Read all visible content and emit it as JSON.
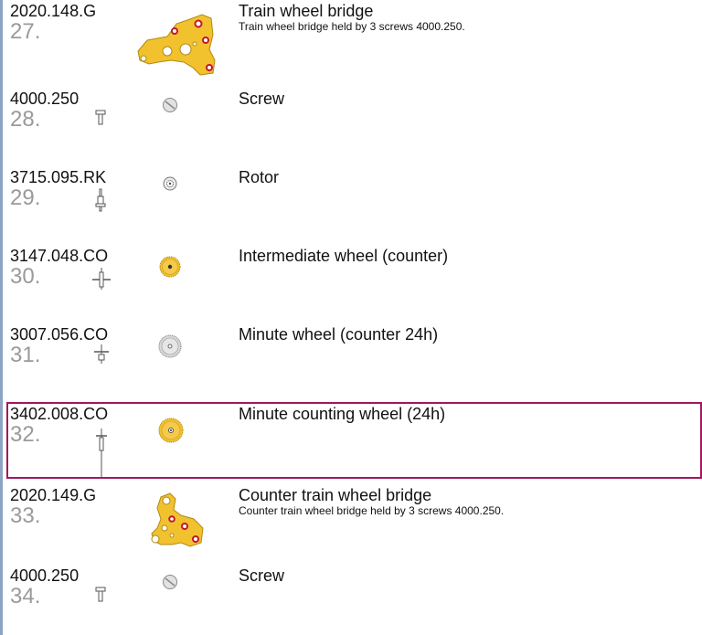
{
  "colors": {
    "accent_rule": "#8da4c2",
    "highlight_border": "#a0185e",
    "part_gold": "#f2c12e",
    "ruby": "#c0182a",
    "number_gray": "#9a9a9a"
  },
  "parts": [
    {
      "ref": "2020.148.G",
      "num": "27.",
      "title": "Train wheel bridge",
      "desc": "Train wheel bridge held by 3 screws 4000.250.",
      "icon": "bridge-icon"
    },
    {
      "ref": "4000.250",
      "num": "28.",
      "title": "Screw",
      "desc": "",
      "icon": "screw-icon"
    },
    {
      "ref": "3715.095.RK",
      "num": "29.",
      "title": "Rotor",
      "desc": "",
      "icon": "rotor-icon"
    },
    {
      "ref": "3147.048.CO",
      "num": "30.",
      "title": "Intermediate wheel (counter)",
      "desc": "",
      "icon": "gear-icon"
    },
    {
      "ref": "3007.056.CO",
      "num": "31.",
      "title": "Minute wheel (counter 24h)",
      "desc": "",
      "icon": "gear-icon"
    },
    {
      "ref": "3402.008.CO",
      "num": "32.",
      "title": "Minute counting wheel (24h)",
      "desc": "",
      "icon": "gear-icon"
    },
    {
      "ref": "2020.149.G",
      "num": "33.",
      "title": "Counter train wheel bridge",
      "desc": "Counter train wheel bridge held by 3 screws 4000.250.",
      "icon": "bridge-icon"
    },
    {
      "ref": "4000.250",
      "num": "34.",
      "title": "Screw",
      "desc": "",
      "icon": "screw-icon"
    }
  ]
}
